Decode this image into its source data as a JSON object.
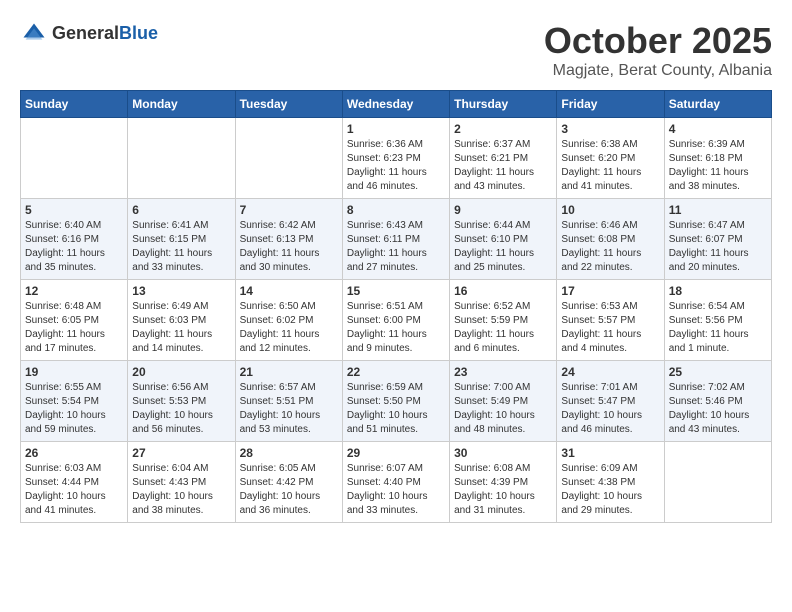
{
  "logo": {
    "general": "General",
    "blue": "Blue"
  },
  "title": {
    "month": "October 2025",
    "location": "Magjate, Berat County, Albania"
  },
  "weekdays": [
    "Sunday",
    "Monday",
    "Tuesday",
    "Wednesday",
    "Thursday",
    "Friday",
    "Saturday"
  ],
  "weeks": [
    [
      {
        "day": "",
        "info": ""
      },
      {
        "day": "",
        "info": ""
      },
      {
        "day": "",
        "info": ""
      },
      {
        "day": "1",
        "info": "Sunrise: 6:36 AM\nSunset: 6:23 PM\nDaylight: 11 hours\nand 46 minutes."
      },
      {
        "day": "2",
        "info": "Sunrise: 6:37 AM\nSunset: 6:21 PM\nDaylight: 11 hours\nand 43 minutes."
      },
      {
        "day": "3",
        "info": "Sunrise: 6:38 AM\nSunset: 6:20 PM\nDaylight: 11 hours\nand 41 minutes."
      },
      {
        "day": "4",
        "info": "Sunrise: 6:39 AM\nSunset: 6:18 PM\nDaylight: 11 hours\nand 38 minutes."
      }
    ],
    [
      {
        "day": "5",
        "info": "Sunrise: 6:40 AM\nSunset: 6:16 PM\nDaylight: 11 hours\nand 35 minutes."
      },
      {
        "day": "6",
        "info": "Sunrise: 6:41 AM\nSunset: 6:15 PM\nDaylight: 11 hours\nand 33 minutes."
      },
      {
        "day": "7",
        "info": "Sunrise: 6:42 AM\nSunset: 6:13 PM\nDaylight: 11 hours\nand 30 minutes."
      },
      {
        "day": "8",
        "info": "Sunrise: 6:43 AM\nSunset: 6:11 PM\nDaylight: 11 hours\nand 27 minutes."
      },
      {
        "day": "9",
        "info": "Sunrise: 6:44 AM\nSunset: 6:10 PM\nDaylight: 11 hours\nand 25 minutes."
      },
      {
        "day": "10",
        "info": "Sunrise: 6:46 AM\nSunset: 6:08 PM\nDaylight: 11 hours\nand 22 minutes."
      },
      {
        "day": "11",
        "info": "Sunrise: 6:47 AM\nSunset: 6:07 PM\nDaylight: 11 hours\nand 20 minutes."
      }
    ],
    [
      {
        "day": "12",
        "info": "Sunrise: 6:48 AM\nSunset: 6:05 PM\nDaylight: 11 hours\nand 17 minutes."
      },
      {
        "day": "13",
        "info": "Sunrise: 6:49 AM\nSunset: 6:03 PM\nDaylight: 11 hours\nand 14 minutes."
      },
      {
        "day": "14",
        "info": "Sunrise: 6:50 AM\nSunset: 6:02 PM\nDaylight: 11 hours\nand 12 minutes."
      },
      {
        "day": "15",
        "info": "Sunrise: 6:51 AM\nSunset: 6:00 PM\nDaylight: 11 hours\nand 9 minutes."
      },
      {
        "day": "16",
        "info": "Sunrise: 6:52 AM\nSunset: 5:59 PM\nDaylight: 11 hours\nand 6 minutes."
      },
      {
        "day": "17",
        "info": "Sunrise: 6:53 AM\nSunset: 5:57 PM\nDaylight: 11 hours\nand 4 minutes."
      },
      {
        "day": "18",
        "info": "Sunrise: 6:54 AM\nSunset: 5:56 PM\nDaylight: 11 hours\nand 1 minute."
      }
    ],
    [
      {
        "day": "19",
        "info": "Sunrise: 6:55 AM\nSunset: 5:54 PM\nDaylight: 10 hours\nand 59 minutes."
      },
      {
        "day": "20",
        "info": "Sunrise: 6:56 AM\nSunset: 5:53 PM\nDaylight: 10 hours\nand 56 minutes."
      },
      {
        "day": "21",
        "info": "Sunrise: 6:57 AM\nSunset: 5:51 PM\nDaylight: 10 hours\nand 53 minutes."
      },
      {
        "day": "22",
        "info": "Sunrise: 6:59 AM\nSunset: 5:50 PM\nDaylight: 10 hours\nand 51 minutes."
      },
      {
        "day": "23",
        "info": "Sunrise: 7:00 AM\nSunset: 5:49 PM\nDaylight: 10 hours\nand 48 minutes."
      },
      {
        "day": "24",
        "info": "Sunrise: 7:01 AM\nSunset: 5:47 PM\nDaylight: 10 hours\nand 46 minutes."
      },
      {
        "day": "25",
        "info": "Sunrise: 7:02 AM\nSunset: 5:46 PM\nDaylight: 10 hours\nand 43 minutes."
      }
    ],
    [
      {
        "day": "26",
        "info": "Sunrise: 6:03 AM\nSunset: 4:44 PM\nDaylight: 10 hours\nand 41 minutes."
      },
      {
        "day": "27",
        "info": "Sunrise: 6:04 AM\nSunset: 4:43 PM\nDaylight: 10 hours\nand 38 minutes."
      },
      {
        "day": "28",
        "info": "Sunrise: 6:05 AM\nSunset: 4:42 PM\nDaylight: 10 hours\nand 36 minutes."
      },
      {
        "day": "29",
        "info": "Sunrise: 6:07 AM\nSunset: 4:40 PM\nDaylight: 10 hours\nand 33 minutes."
      },
      {
        "day": "30",
        "info": "Sunrise: 6:08 AM\nSunset: 4:39 PM\nDaylight: 10 hours\nand 31 minutes."
      },
      {
        "day": "31",
        "info": "Sunrise: 6:09 AM\nSunset: 4:38 PM\nDaylight: 10 hours\nand 29 minutes."
      },
      {
        "day": "",
        "info": ""
      }
    ]
  ]
}
